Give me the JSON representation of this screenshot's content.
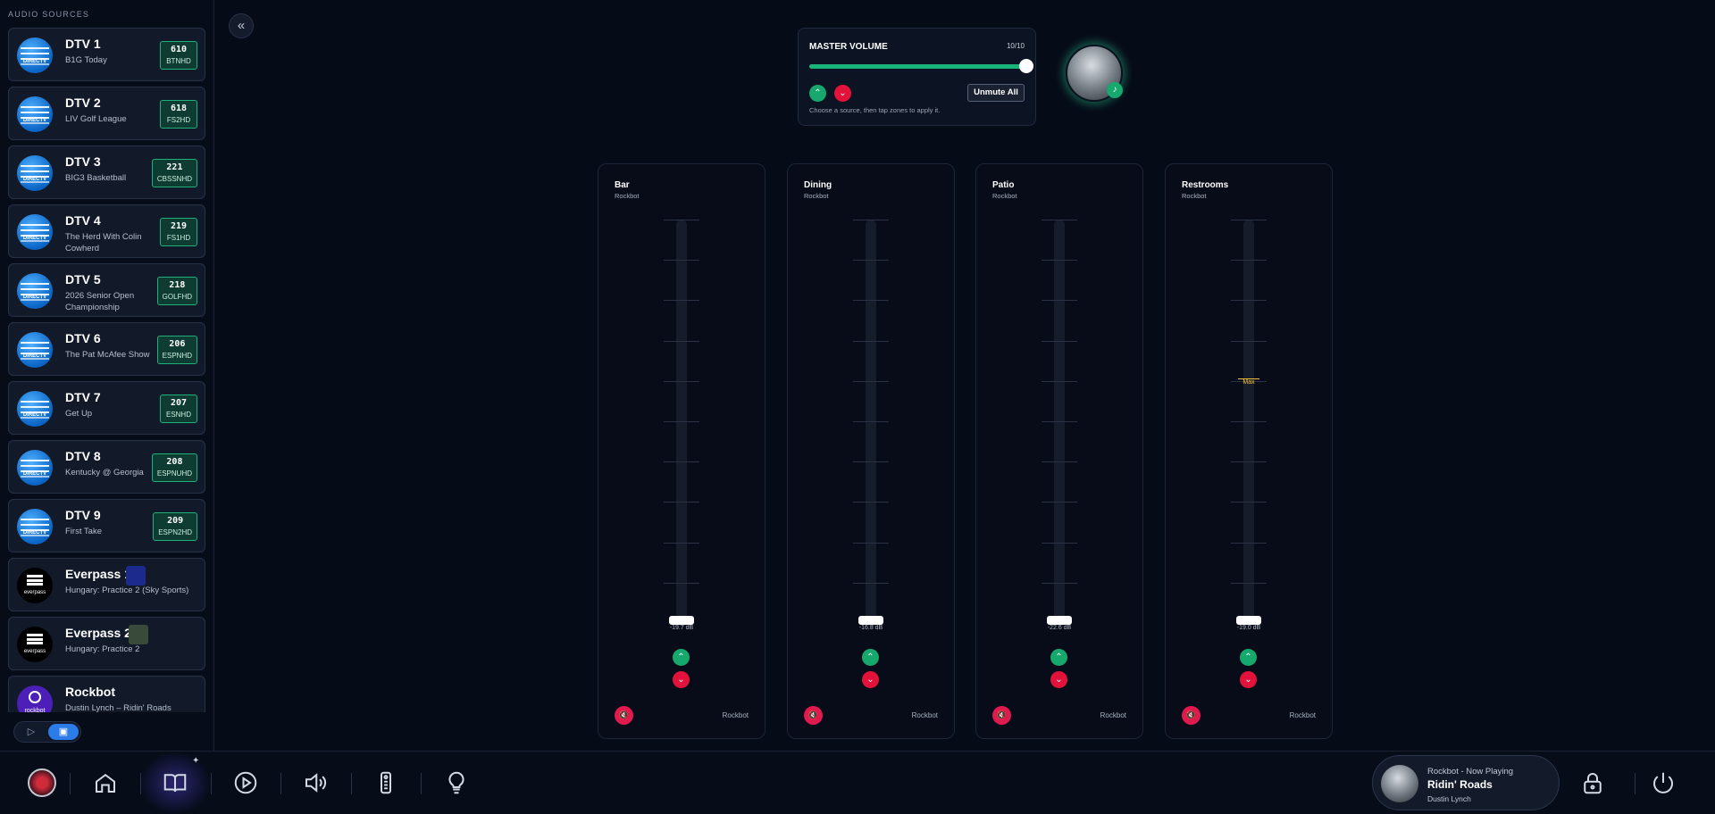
{
  "sidebar": {
    "title": "AUDIO SOURCES",
    "sources": [
      {
        "name": "DTV 1",
        "sub": "B1G Today",
        "ch": "610",
        "cs": "BTNHD",
        "type": "att"
      },
      {
        "name": "DTV 2",
        "sub": "LIV Golf League",
        "ch": "618",
        "cs": "FS2HD",
        "type": "att"
      },
      {
        "name": "DTV 3",
        "sub": "BIG3 Basketball",
        "ch": "221",
        "cs": "CBSSNHD",
        "type": "att"
      },
      {
        "name": "DTV 4",
        "sub": "The Herd With Colin Cowherd",
        "ch": "219",
        "cs": "FS1HD",
        "type": "att"
      },
      {
        "name": "DTV 5",
        "sub": "2026 Senior Open Championship",
        "ch": "218",
        "cs": "GOLFHD",
        "type": "att"
      },
      {
        "name": "DTV 6",
        "sub": "The Pat McAfee Show",
        "ch": "206",
        "cs": "ESPNHD",
        "type": "att"
      },
      {
        "name": "DTV 7",
        "sub": "Get Up",
        "ch": "207",
        "cs": "ESNHD",
        "type": "att"
      },
      {
        "name": "DTV 8",
        "sub": "Kentucky @ Georgia",
        "ch": "208",
        "cs": "ESPNUHD",
        "type": "att"
      },
      {
        "name": "DTV 9",
        "sub": "First Take",
        "ch": "209",
        "cs": "ESPN2HD",
        "type": "att"
      },
      {
        "name": "Everpass 1",
        "sub": "Hungary: Practice 2 (Sky Sports)",
        "type": "ever",
        "logo_text": "everpass"
      },
      {
        "name": "Everpass 2",
        "sub": "Hungary: Practice 2",
        "type": "ever",
        "logo_text": "everpass"
      },
      {
        "name": "Rockbot",
        "sub": "Dustin Lynch – Ridin' Roads",
        "type": "rock",
        "logo_text": "rockbot"
      }
    ]
  },
  "master": {
    "title": "MASTER VOLUME",
    "level": "10/10",
    "level_fraction": 1.0,
    "unmute_label": "Unmute All",
    "hint": "Choose a source, then tap zones to apply it."
  },
  "zones": [
    {
      "name": "Bar",
      "source": "Rockbot",
      "db": "-19.7 dB",
      "level": 0.0
    },
    {
      "name": "Dining",
      "source": "Rockbot",
      "db": "-16.8 dB",
      "level": 0.0
    },
    {
      "name": "Patio",
      "source": "Rockbot",
      "db": "-22.6 dB",
      "level": 0.0
    },
    {
      "name": "Restrooms",
      "source": "Rockbot",
      "db": "-19.0 dB",
      "level": 0.0,
      "max_label": "Max",
      "max_level": 0.6
    }
  ],
  "now_playing": {
    "source": "Rockbot - Now Playing",
    "song": "Ridin' Roads",
    "artist": "Dustin Lynch"
  },
  "colors": {
    "accent": "#18b47a",
    "danger": "#e3123a",
    "toggle": "#2b7be8"
  }
}
